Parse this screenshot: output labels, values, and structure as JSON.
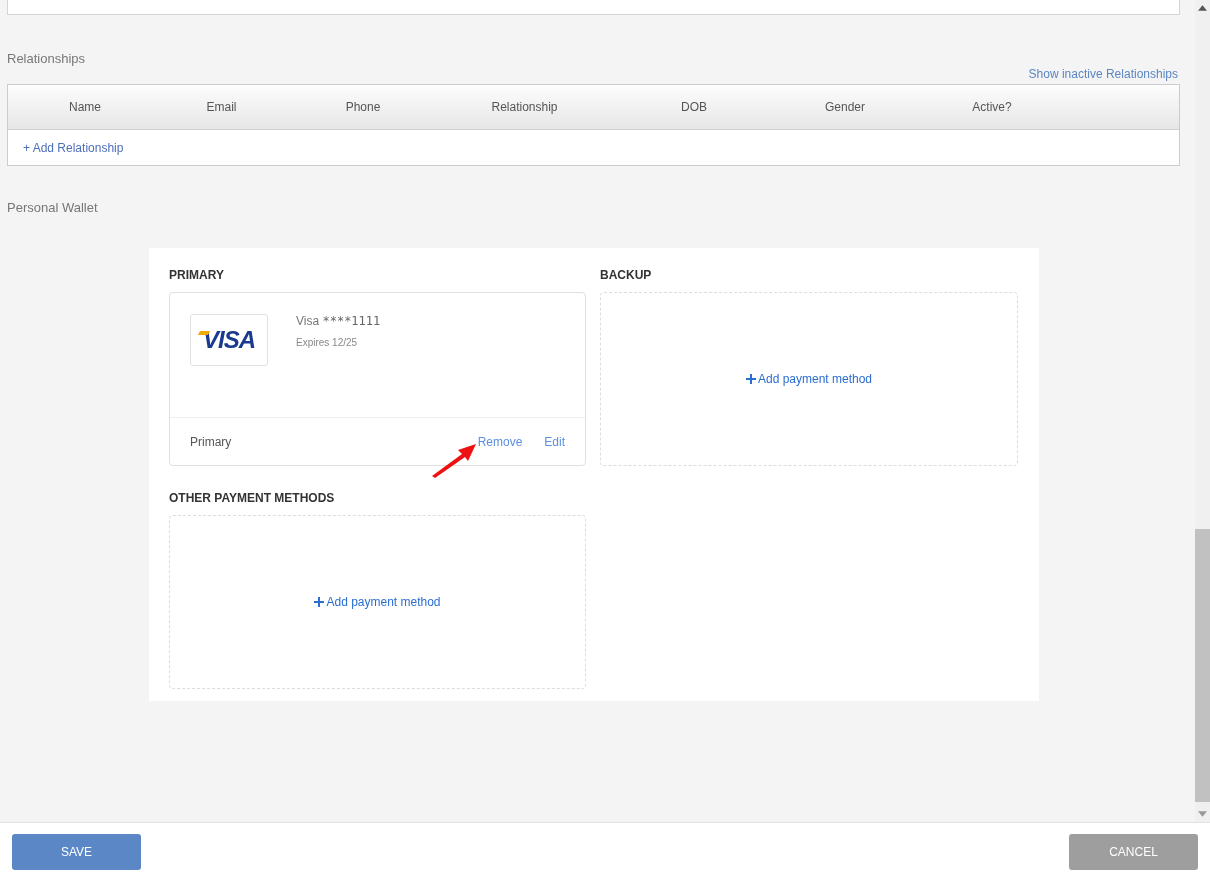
{
  "relationships": {
    "title": "Relationships",
    "show_inactive_link": "Show inactive Relationships",
    "table": {
      "columns": [
        "Name",
        "Email",
        "Phone",
        "Relationship",
        "DOB",
        "Gender",
        "Active?"
      ],
      "add_link": "+ Add Relationship"
    }
  },
  "wallet": {
    "title": "Personal Wallet",
    "primary": {
      "heading": "PRIMARY",
      "card": {
        "logo": "VISA",
        "brand": "Visa",
        "number": "****1111",
        "expires": "Expires 12/25",
        "footer_label": "Primary",
        "remove": "Remove",
        "edit": "Edit"
      }
    },
    "backup": {
      "heading": "BACKUP",
      "add": "Add payment method"
    },
    "other": {
      "heading": "OTHER PAYMENT METHODS",
      "add": "Add payment method"
    }
  },
  "footer": {
    "save": "SAVE",
    "cancel": "CANCEL"
  }
}
